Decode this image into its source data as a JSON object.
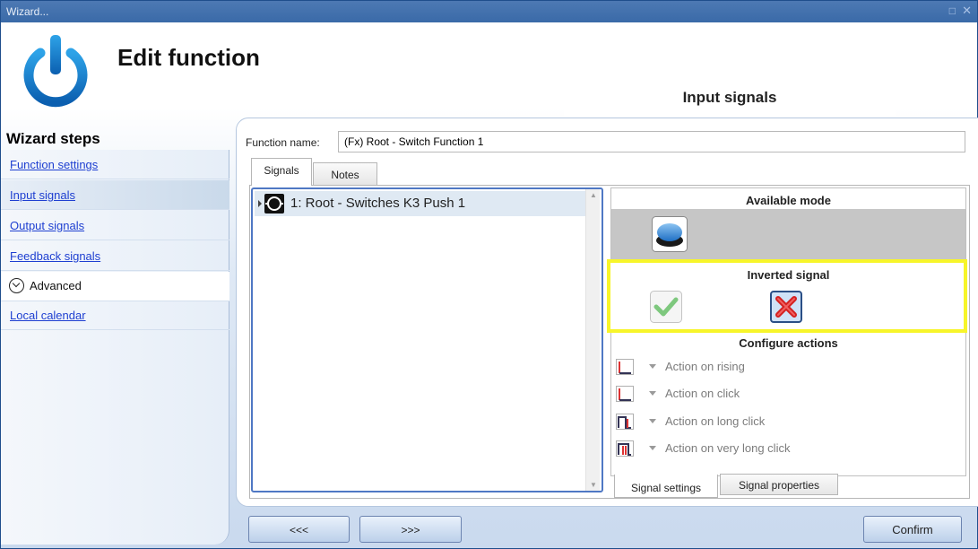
{
  "window": {
    "title": "Wizard...",
    "maximize_glyph": "□",
    "close_glyph": "✕"
  },
  "header": {
    "title": "Edit function",
    "current_step": "Input signals",
    "logo_icon": "power-icon"
  },
  "wizard_steps": {
    "title": "Wizard steps",
    "items": [
      {
        "label": "Function settings",
        "active": false
      },
      {
        "label": "Input signals",
        "active": true
      },
      {
        "label": "Output signals",
        "active": false
      },
      {
        "label": "Feedback signals",
        "active": false
      }
    ],
    "advanced_label": "Advanced",
    "advanced_items": [
      {
        "label": "Local calendar"
      }
    ]
  },
  "function": {
    "name_label": "Function name:",
    "name_value": "(Fx) Root - Switch Function 1"
  },
  "tabs": {
    "signals": "Signals",
    "notes": "Notes"
  },
  "signals": [
    {
      "label": "1: Root - Switches K3 Push 1",
      "icon": "switch-icon"
    }
  ],
  "available_mode": {
    "title": "Available mode",
    "icon": "push-button-icon"
  },
  "inverted_signal": {
    "title": "Inverted signal",
    "options": [
      "check-icon",
      "cross-icon"
    ],
    "selected": "cross-icon"
  },
  "configure_actions": {
    "title": "Configure actions",
    "items": [
      {
        "label": "Action on rising",
        "icon": "rising-edge-icon"
      },
      {
        "label": "Action on click",
        "icon": "click-icon"
      },
      {
        "label": "Action on long click",
        "icon": "long-click-icon"
      },
      {
        "label": "Action on very long click",
        "icon": "very-long-click-icon"
      }
    ]
  },
  "bottom_tabs": {
    "signal_settings": "Signal settings",
    "signal_properties": "Signal properties"
  },
  "buttons": {
    "prev": "<<<",
    "next": ">>>",
    "confirm": "Confirm"
  },
  "colors": {
    "title_bar": "#3a6aa8",
    "highlight": "#f7f52a",
    "link": "#1e3fd1",
    "selection": "#dfe9f3"
  }
}
